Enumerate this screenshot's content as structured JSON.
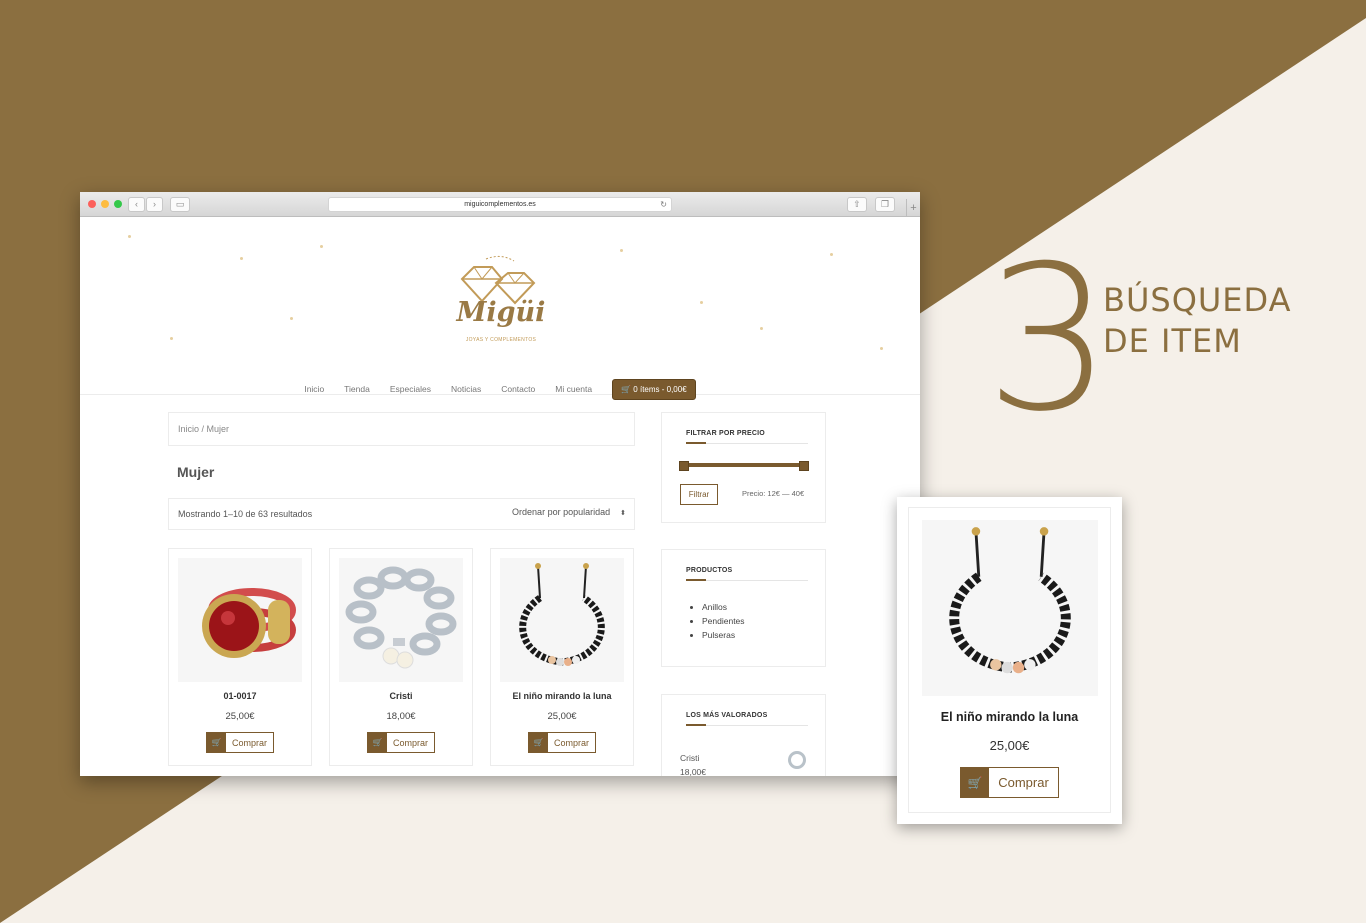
{
  "step": {
    "number": "3",
    "title_line1": "BÚSQUEDA",
    "title_line2": "DE ITEM"
  },
  "browser": {
    "url": "miguicomplementos.es"
  },
  "site": {
    "logo_name": "Migüi",
    "logo_tagline": "JOYAS Y COMPLEMENTOS",
    "nav": [
      "Inicio",
      "Tienda",
      "Especiales",
      "Noticias",
      "Contacto",
      "Mi cuenta"
    ],
    "cart_label": "0 ítems - 0,00€"
  },
  "shop": {
    "breadcrumb": "Inicio / Mujer",
    "title": "Mujer",
    "results": "Mostrando 1–10 de 63 resultados",
    "sort": "Ordenar por popularidad",
    "buy_label": "Comprar",
    "products": [
      {
        "name": "01-0017",
        "price": "25,00€"
      },
      {
        "name": "Cristi",
        "price": "18,00€"
      },
      {
        "name": "El niño mirando la luna",
        "price": "25,00€"
      }
    ]
  },
  "sidebar": {
    "price_filter": {
      "title": "FILTRAR POR PRECIO",
      "button": "Filtrar",
      "range": "Precio: 12€ — 40€"
    },
    "categories": {
      "title": "PRODUCTOS",
      "items": [
        "Anillos",
        "Pendientes",
        "Pulseras"
      ]
    },
    "top_rated": {
      "title": "LOS MÁS VALORADOS",
      "item_name": "Cristi",
      "item_price": "18,00€"
    }
  },
  "zoom": {
    "name": "El niño mirando la luna",
    "price": "25,00€",
    "buy_label": "Comprar"
  },
  "colors": {
    "brand": "#8b6f40",
    "button": "#7a5a2e",
    "background": "#f5f0e9"
  }
}
